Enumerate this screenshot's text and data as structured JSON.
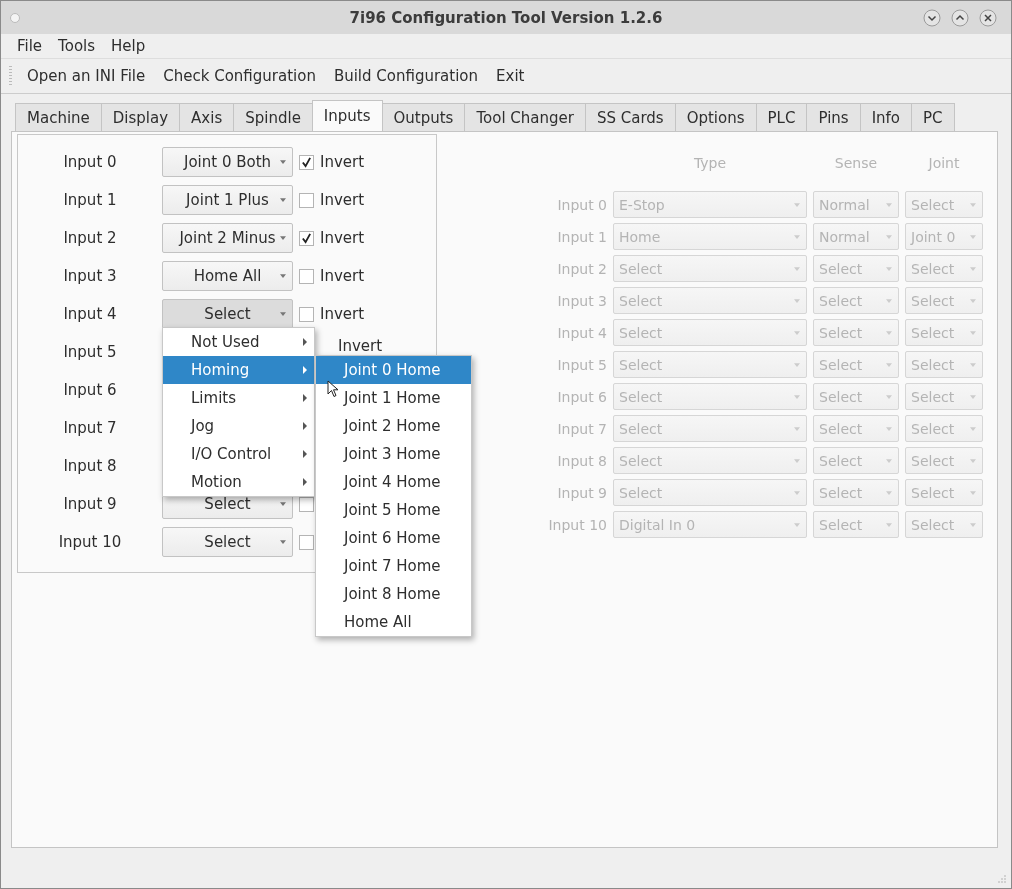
{
  "window": {
    "title": "7i96 Configuration Tool Version 1.2.6"
  },
  "menu_bar": [
    {
      "label": "File"
    },
    {
      "label": "Tools"
    },
    {
      "label": "Help"
    }
  ],
  "toolbar": [
    {
      "label": "Open an INI File"
    },
    {
      "label": "Check Configuration"
    },
    {
      "label": "Build Configuration"
    },
    {
      "label": "Exit"
    }
  ],
  "tabs": [
    {
      "label": "Machine",
      "selected": false
    },
    {
      "label": "Display",
      "selected": false
    },
    {
      "label": "Axis",
      "selected": false
    },
    {
      "label": "Spindle",
      "selected": false
    },
    {
      "label": "Inputs",
      "selected": true
    },
    {
      "label": "Outputs",
      "selected": false
    },
    {
      "label": "Tool Changer",
      "selected": false
    },
    {
      "label": "SS Cards",
      "selected": false
    },
    {
      "label": "Options",
      "selected": false
    },
    {
      "label": "PLC",
      "selected": false
    },
    {
      "label": "Pins",
      "selected": false
    },
    {
      "label": "Info",
      "selected": false
    },
    {
      "label": "PC",
      "selected": false
    }
  ],
  "inputs": [
    {
      "label": "Input 0",
      "value": "Joint 0 Both",
      "checked": true,
      "invert_label": "Invert"
    },
    {
      "label": "Input 1",
      "value": "Joint 1 Plus",
      "checked": false,
      "invert_label": "Invert"
    },
    {
      "label": "Input 2",
      "value": "Joint 2 Minus",
      "checked": true,
      "invert_label": "Invert"
    },
    {
      "label": "Input 3",
      "value": "Home All",
      "checked": false,
      "invert_label": "Invert"
    },
    {
      "label": "Input 4",
      "value": "Select",
      "checked": false,
      "invert_label": "Invert",
      "open": true
    },
    {
      "label": "Input 5",
      "invert_label": "Invert"
    },
    {
      "label": "Input 6"
    },
    {
      "label": "Input 7"
    },
    {
      "label": "Input 8"
    },
    {
      "label": "Input 9",
      "value": "Select",
      "checked": false
    },
    {
      "label": "Input 10",
      "value": "Select",
      "checked": false
    }
  ],
  "pin_table": {
    "disabled": true,
    "columns": [
      "Type",
      "Sense",
      "Joint"
    ],
    "rows": [
      {
        "label": "Input 0",
        "type": "E-Stop",
        "sense": "Normal",
        "joint": "Select"
      },
      {
        "label": "Input 1",
        "type": "Home",
        "sense": "Normal",
        "joint": "Joint 0"
      },
      {
        "label": "Input 2",
        "type": "Select",
        "sense": "Select",
        "joint": "Select"
      },
      {
        "label": "Input 3",
        "type": "Select",
        "sense": "Select",
        "joint": "Select"
      },
      {
        "label": "Input 4",
        "type": "Select",
        "sense": "Select",
        "joint": "Select"
      },
      {
        "label": "Input 5",
        "type": "Select",
        "sense": "Select",
        "joint": "Select"
      },
      {
        "label": "Input 6",
        "type": "Select",
        "sense": "Select",
        "joint": "Select"
      },
      {
        "label": "Input 7",
        "type": "Select",
        "sense": "Select",
        "joint": "Select"
      },
      {
        "label": "Input 8",
        "type": "Select",
        "sense": "Select",
        "joint": "Select"
      },
      {
        "label": "Input 9",
        "type": "Select",
        "sense": "Select",
        "joint": "Select"
      },
      {
        "label": "Input 10",
        "type": "Digital In 0",
        "sense": "Select",
        "joint": "Select"
      }
    ]
  },
  "popup_menu": [
    {
      "label": "Not Used",
      "selected": false
    },
    {
      "label": "Homing",
      "selected": true
    },
    {
      "label": "Limits",
      "selected": false
    },
    {
      "label": "Jog",
      "selected": false
    },
    {
      "label": "I/O Control",
      "selected": false
    },
    {
      "label": "Motion",
      "selected": false
    }
  ],
  "submenu": [
    {
      "label": "Joint 0 Home",
      "selected": true
    },
    {
      "label": "Joint 1 Home",
      "selected": false
    },
    {
      "label": "Joint 2 Home",
      "selected": false
    },
    {
      "label": "Joint 3 Home",
      "selected": false
    },
    {
      "label": "Joint 4 Home",
      "selected": false
    },
    {
      "label": "Joint 5 Home",
      "selected": false
    },
    {
      "label": "Joint 6 Home",
      "selected": false
    },
    {
      "label": "Joint 7 Home",
      "selected": false
    },
    {
      "label": "Joint 8 Home",
      "selected": false
    },
    {
      "label": "Home All",
      "selected": false
    }
  ]
}
